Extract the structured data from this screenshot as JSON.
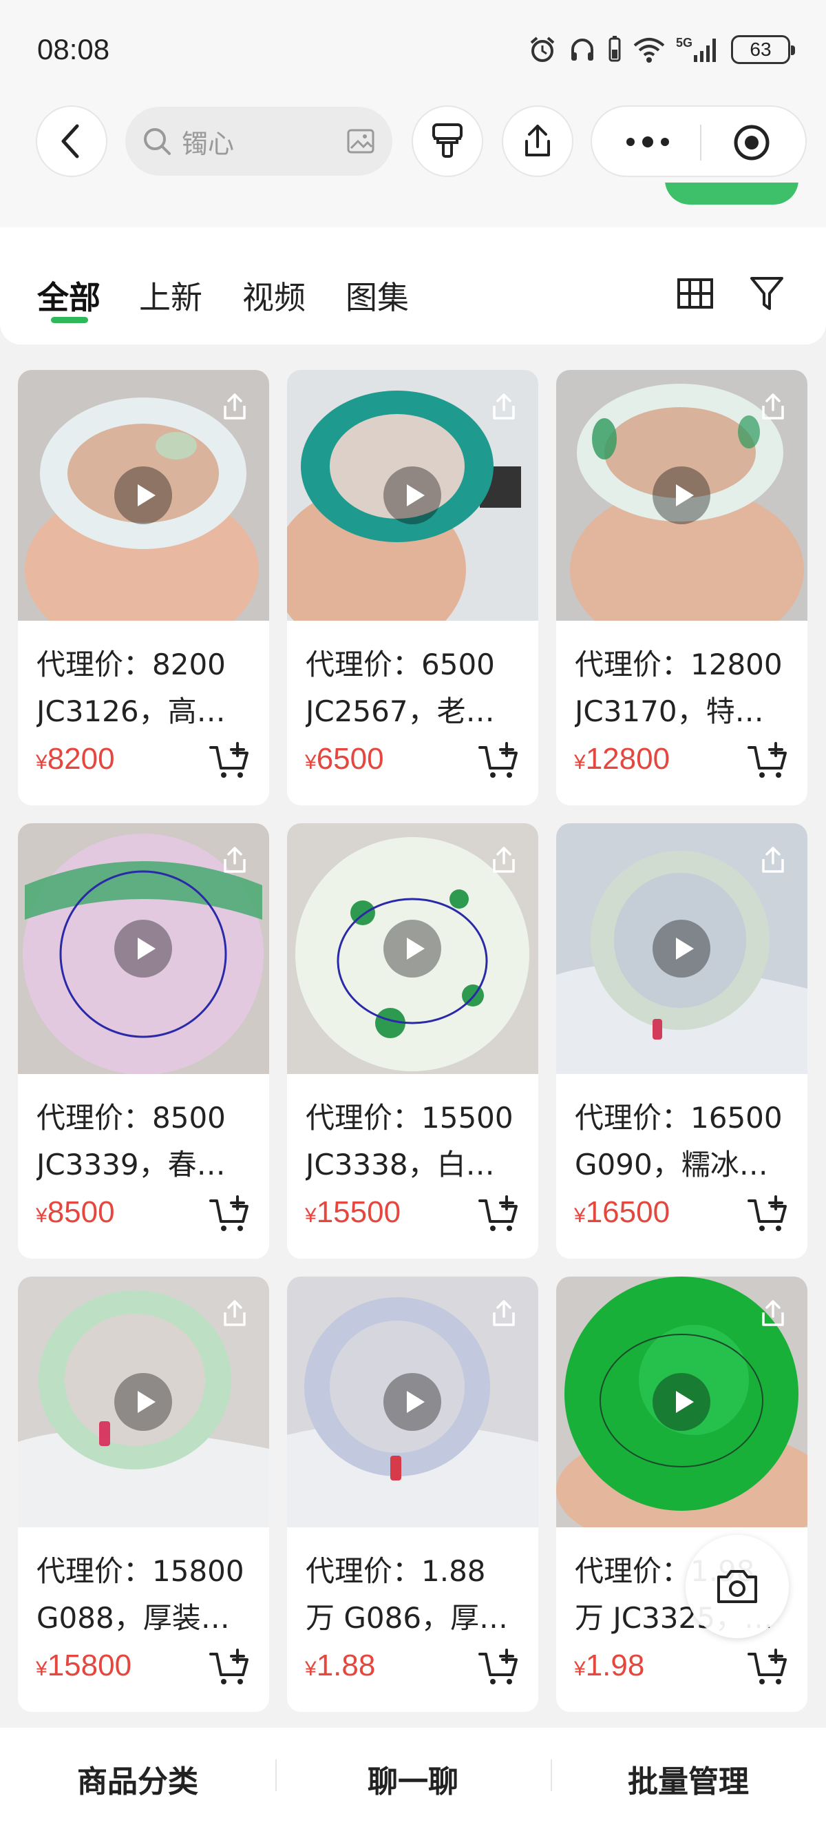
{
  "status_bar": {
    "time": "08:08",
    "network": "5G",
    "battery": "63"
  },
  "nav": {
    "search_placeholder": "镯心",
    "icons": [
      "back-icon",
      "search-icon",
      "image-search-icon",
      "brush-icon",
      "share-icon",
      "more-icon",
      "record-icon"
    ]
  },
  "tabs": [
    "全部",
    "上新",
    "视频",
    "图集"
  ],
  "active_tab": 0,
  "colors": {
    "accent": "#2eb85a",
    "price": "#e5473e"
  },
  "products": [
    {
      "line1": "代理价：8200",
      "line2": "JC3126，高…",
      "currency": "¥",
      "price": "8200"
    },
    {
      "line1": "代理价：6500",
      "line2": "JC2567，老…",
      "currency": "¥",
      "price": "6500"
    },
    {
      "line1": "代理价：12800",
      "line2": "JC3170，特…",
      "currency": "¥",
      "price": "12800"
    },
    {
      "line1": "代理价：8500",
      "line2": "JC3339，春…",
      "currency": "¥",
      "price": "8500"
    },
    {
      "line1": "代理价：15500",
      "line2": "JC3338，白…",
      "currency": "¥",
      "price": "15500"
    },
    {
      "line1": "代理价：16500",
      "line2": "G090，糯冰…",
      "currency": "¥",
      "price": "16500"
    },
    {
      "line1": "代理价：15800",
      "line2": "G088，厚装…",
      "currency": "¥",
      "price": "15800"
    },
    {
      "line1": "代理价：1.88",
      "line2": "万 G086，厚…",
      "currency": "¥",
      "price": "1.88"
    },
    {
      "line1": "代理价：1.98",
      "line2": "万 JC3325，…",
      "currency": "¥",
      "price": "1.98"
    }
  ],
  "bottom_bar": [
    "商品分类",
    "聊一聊",
    "批量管理"
  ]
}
